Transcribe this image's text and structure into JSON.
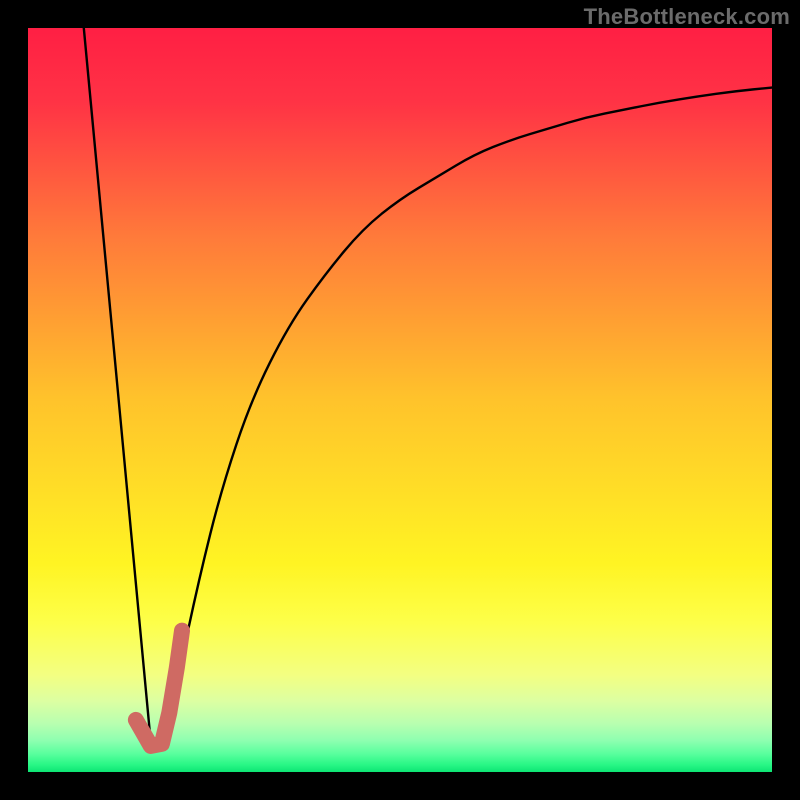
{
  "attribution": {
    "text": "TheBottleneck.com"
  },
  "chart_data": {
    "type": "line",
    "title": "",
    "xlabel": "",
    "ylabel": "",
    "xlim": [
      0,
      100
    ],
    "ylim": [
      0,
      100
    ],
    "grid": false,
    "legend": false,
    "note": "Values estimated from unlabeled plot; y read as height inside inner plot area.",
    "series": [
      {
        "name": "left-line",
        "color": "#000000",
        "x": [
          7.5,
          16.5
        ],
        "values": [
          100,
          4
        ]
      },
      {
        "name": "right-curve",
        "color": "#000000",
        "x": [
          18,
          20,
          23,
          26,
          30,
          35,
          40,
          45,
          50,
          55,
          60,
          65,
          70,
          75,
          80,
          85,
          90,
          95,
          100
        ],
        "values": [
          4,
          12,
          26,
          38,
          50,
          60,
          67,
          73,
          77,
          80,
          83,
          85,
          86.5,
          88,
          89,
          90,
          90.8,
          91.5,
          92
        ]
      },
      {
        "name": "highlight-tick",
        "color": "#cf6a63",
        "x": [
          14.5,
          16.5,
          18,
          19,
          20,
          20.7
        ],
        "values": [
          7,
          3.5,
          3.8,
          8,
          14,
          19
        ]
      }
    ],
    "background": {
      "type": "vertical-gradient",
      "stops": [
        {
          "offset": 0.0,
          "color": "#ff1f44"
        },
        {
          "offset": 0.1,
          "color": "#ff3345"
        },
        {
          "offset": 0.28,
          "color": "#ff7a3a"
        },
        {
          "offset": 0.5,
          "color": "#ffc32b"
        },
        {
          "offset": 0.72,
          "color": "#fff423"
        },
        {
          "offset": 0.8,
          "color": "#fdff4a"
        },
        {
          "offset": 0.87,
          "color": "#f3ff82"
        },
        {
          "offset": 0.905,
          "color": "#dcffa2"
        },
        {
          "offset": 0.935,
          "color": "#b8ffb0"
        },
        {
          "offset": 0.958,
          "color": "#8dffb0"
        },
        {
          "offset": 0.975,
          "color": "#5bff9e"
        },
        {
          "offset": 0.99,
          "color": "#29f786"
        },
        {
          "offset": 1.0,
          "color": "#0de574"
        }
      ]
    }
  }
}
